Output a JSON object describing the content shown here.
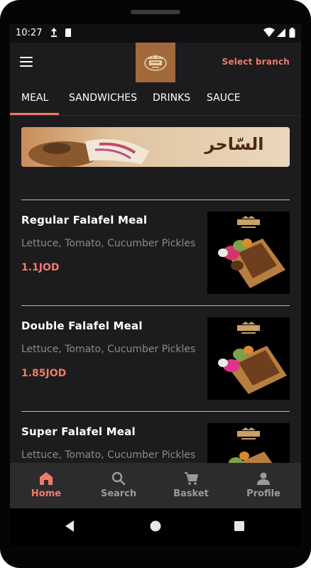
{
  "status_bar": {
    "time": "10:27",
    "left_icons": [
      "navigation-icon",
      "sd-card-icon"
    ],
    "right_icons": [
      "wifi-icon",
      "signal-icon",
      "battery-icon"
    ]
  },
  "app_bar": {
    "menu_icon": "hamburger-menu-icon",
    "logo": "restaurant-logo",
    "select_branch": "Select branch"
  },
  "tabs": [
    {
      "label": "MEAL",
      "active": true
    },
    {
      "label": "SANDWICHES",
      "active": false
    },
    {
      "label": "DRINKS",
      "active": false
    },
    {
      "label": "SAUCE",
      "active": false
    }
  ],
  "banner": {
    "text": "السّاحر"
  },
  "items": [
    {
      "name": "Regular Falafel Meal",
      "description": "Lettuce, Tomato, Cucumber Pickles",
      "price": "1.1JOD"
    },
    {
      "name": "Double Falafel Meal",
      "description": "Lettuce, Tomato, Cucumber Pickles",
      "price": "1.85JOD"
    },
    {
      "name": "Super Falafel Meal",
      "description": "Lettuce, Tomato, Cucumber Pickles",
      "price": ""
    }
  ],
  "bottom_nav": [
    {
      "label": "Home",
      "icon": "home-icon",
      "active": true
    },
    {
      "label": "Search",
      "icon": "search-icon",
      "active": false
    },
    {
      "label": "Basket",
      "icon": "cart-icon",
      "active": false
    },
    {
      "label": "Profile",
      "icon": "person-icon",
      "active": false
    }
  ],
  "system_nav": [
    "back-icon",
    "home-circle-icon",
    "recents-icon"
  ],
  "colors": {
    "accent": "#f07a6a",
    "background": "#1c1c1e",
    "nav_background": "#2c2c2e",
    "logo_background": "#a2693a"
  }
}
